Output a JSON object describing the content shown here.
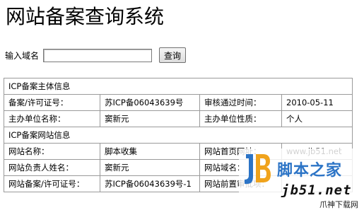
{
  "page": {
    "title": "网站备案查询系统"
  },
  "search": {
    "label": "输入域名",
    "value": "",
    "button_label": "查询"
  },
  "table": {
    "section1_header": "ICP备案主体信息",
    "row1": [
      "备案/许可证号：",
      "苏ICP备06043639号",
      "审核通过时间：",
      "2010-05-11"
    ],
    "row2": [
      "主办单位名称：",
      "窦新元",
      "主办单位性质：",
      "个人"
    ],
    "section2_header": "ICP备案网站信息",
    "row3": [
      "网站名称：",
      "脚本收集",
      "网站首页网址：",
      "www.jb51.net"
    ],
    "row4": [
      "网站负责人姓名：",
      "窦新元",
      "网站域名：",
      ""
    ],
    "row5": [
      "网站备案/许可证号：",
      "苏ICP备06043639号-1",
      "网站前置审批项：",
      ""
    ]
  },
  "watermark": {
    "brand_cn": "脚本之家",
    "brand_url": "jb51.net",
    "corner_text": "爪神下载网",
    "brand_color": "#2c74c6",
    "accent_color": "#f0a31c"
  }
}
